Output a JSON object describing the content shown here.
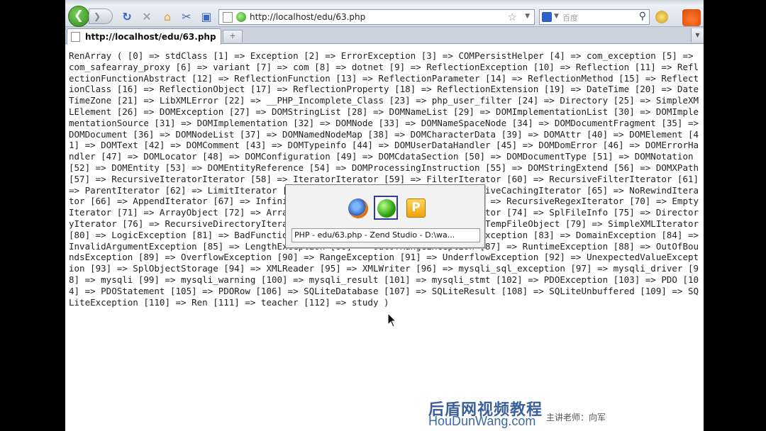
{
  "browser": {
    "url": "http://localhost/edu/63.php",
    "tab_title": "http://localhost/edu/63.php",
    "search_placeholder": "百度",
    "back_glyph": "❮",
    "forward_glyph": "❯",
    "new_tab_glyph": "+",
    "icons": [
      "back-icon",
      "forward-icon",
      "reload-icon",
      "stop-icon",
      "home-icon",
      "cut-icon",
      "screenshot-icon",
      "page-icon",
      "globe-icon",
      "bookmark-star-icon",
      "search-icon",
      "addon-gear-icon",
      "firefox-extension-icon"
    ]
  },
  "content": {
    "text": "RenArray ( [0] => stdClass [1] => Exception [2] => ErrorException [3] => COMPersistHelper [4] => com_exception [5] => com_safearray_proxy [6] => variant [7] => com [8] => dotnet [9] => ReflectionException [10] => Reflection [11] => ReflectionFunctionAbstract [12] => ReflectionFunction [13] => ReflectionParameter [14] => ReflectionMethod [15] => ReflectionClass [16] => ReflectionObject [17] => ReflectionProperty [18] => ReflectionExtension [19] => DateTime [20] => DateTimeZone [21] => LibXMLError [22] => __PHP_Incomplete_Class [23] => php_user_filter [24] => Directory [25] => SimpleXMLElement [26] => DOMException [27] => DOMStringList [28] => DOMNameList [29] => DOMImplementationList [30] => DOMImplementationSource [31] => DOMImplementation [32] => DOMNode [33] => DOMNameSpaceNode [34] => DOMDocumentFragment [35] => DOMDocument [36] => DOMNodeList [37] => DOMNamedNodeMap [38] => DOMCharacterData [39] => DOMAttr [40] => DOMElement [41] => DOMText [42] => DOMComment [43] => DOMTypeinfo [44] => DOMUserDataHandler [45] => DOMDomError [46] => DOMErrorHandler [47] => DOMLocator [48] => DOMConfiguration [49] => DOMCdataSection [50] => DOMDocumentType [51] => DOMNotation [52] => DOMEntity [53] => DOMEntityReference [54] => DOMProcessingInstruction [55] => DOMStringExtend [56] => DOMXPath [57] => RecursiveIteratorIterator [58] => IteratorIterator [59] => FilterIterator [60] => RecursiveFilterIterator [61] => ParentIterator [62] => LimitIterator [63] => CachingIterator [64] => RecursiveCachingIterator [65] => NoRewindIterator [66] => AppendIterator [67] => InfiniteIterator [68] => RegexIterator [69] => RecursiveRegexIterator [70] => EmptyIterator [71] => ArrayObject [72] => ArrayIterator [73] => RecursiveArrayIterator [74] => SplFileInfo [75] => DirectoryIterator [76] => RecursiveDirectoryIterator [77] => SplFileObject [78] => SplTempFileObject [79] => SimpleXMLIterator [80] => LogicException [81] => BadFunctionCallException [82] => BadMethodCallException [83] => DomainException [84] => InvalidArgumentException [85] => LengthException [86] => OutOfRangeException [87] => RuntimeException [88] => OutOfBoundsException [89] => OverflowException [90] => RangeException [91] => UnderflowException [92] => UnexpectedValueException [93] => SplObjectStorage [94] => XMLReader [95] => XMLWriter [96] => mysqli_sql_exception [97] => mysqli_driver [98] => mysqli [99] => mysqli_warning [100] => mysqli_result [101] => mysqli_stmt [102] => PDOException [103] => PDO [104] => PDOStatement [105] => PDORow [106] => SQLiteDatabase [107] => SQLiteResult [108] => SQLiteUnbuffered [109] => SQLiteException [110] => Ren [111] => teacher [112] => study )"
  },
  "switcher": {
    "label": "PHP - edu/63.php - Zend Studio - D:\\wa...",
    "p_glyph": "P",
    "items": [
      "firefox-icon",
      "green-app-icon",
      "p-app-icon"
    ]
  },
  "watermark": {
    "brand": "后盾网视频教程",
    "site": "HouDunWang.com",
    "teacher": "主讲老师：向军"
  }
}
